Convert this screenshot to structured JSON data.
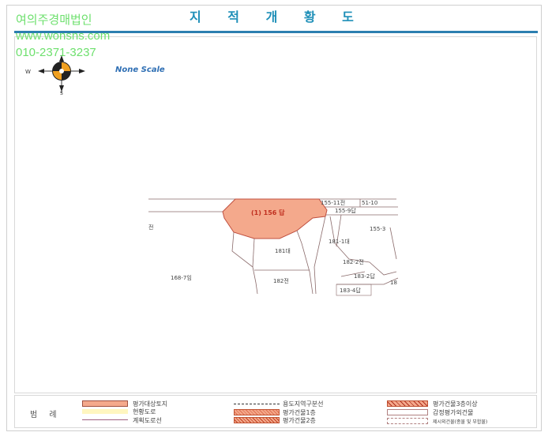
{
  "title": "지 적 개 황 도",
  "watermark": {
    "company": "여의주경매법인",
    "site": "www.wonsns.com",
    "phone": "010-2371-3237"
  },
  "scale_label": "None Scale",
  "compass": {
    "n": "N",
    "s": "S",
    "e": "E",
    "w": "W"
  },
  "map": {
    "subject_label": "(1) 156 답",
    "parcels": [
      "155-11전",
      "51-10",
      "155-9답",
      "155-3",
      "181-1대",
      "181대",
      "182-2전",
      "183-2답",
      "168-7임",
      "182전",
      "183-4답",
      "18",
      "전"
    ]
  },
  "legend": {
    "heading": "범 례",
    "items": [
      "평가대상토지",
      "현황도로",
      "계획도로선",
      "용도지역구분선",
      "평가건물1층",
      "평가건물2층",
      "평가건물3층이상",
      "감정평가외건물",
      "제시외건물(종물 및 부합물)"
    ]
  },
  "colors": {
    "subject": "#f4a98c",
    "title": "#1e8fb8",
    "watermark": "#6ee06e",
    "rule": "#2c7fb0"
  }
}
